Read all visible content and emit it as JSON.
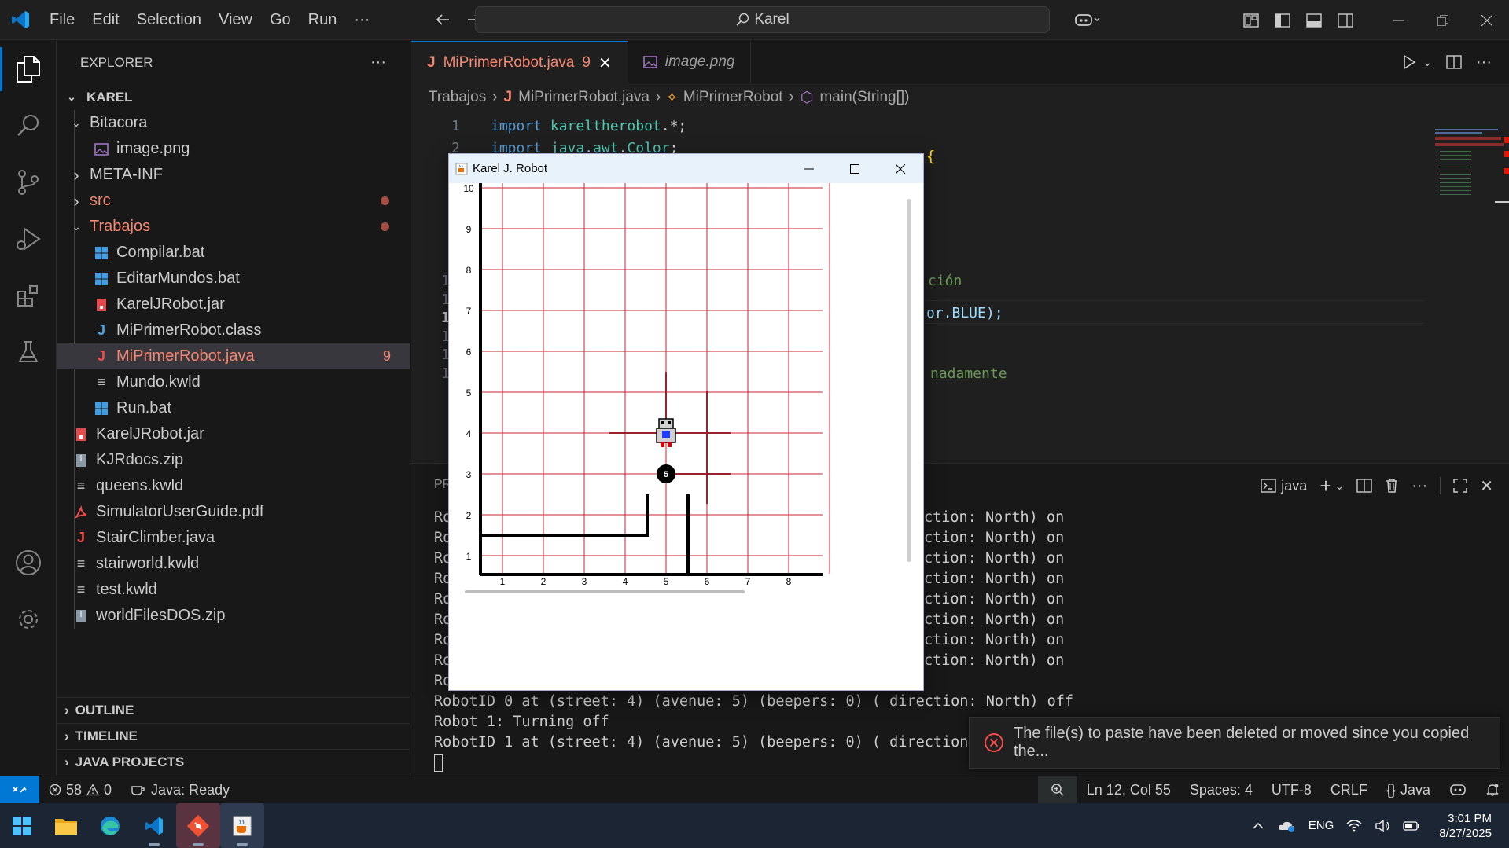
{
  "titlebar": {
    "menus": [
      "File",
      "Edit",
      "Selection",
      "View",
      "Go",
      "Run",
      "···"
    ],
    "search": "Karel",
    "window_controls": [
      "minimize",
      "restore",
      "close"
    ]
  },
  "sidebar": {
    "title": "EXPLORER",
    "more": "···",
    "root": "KAREL",
    "items": [
      {
        "label": "Bitacora",
        "kind": "folder-open",
        "depth": 1
      },
      {
        "label": "image.png",
        "kind": "image",
        "depth": 2
      },
      {
        "label": "META-INF",
        "kind": "folder",
        "depth": 1
      },
      {
        "label": "src",
        "kind": "folder",
        "depth": 1,
        "red": true,
        "dot": true
      },
      {
        "label": "Trabajos",
        "kind": "folder-open",
        "depth": 1,
        "red": true,
        "dot": true
      },
      {
        "label": "Compilar.bat",
        "kind": "windows",
        "depth": 2
      },
      {
        "label": "EditarMundos.bat",
        "kind": "windows",
        "depth": 2
      },
      {
        "label": "KarelJRobot.jar",
        "kind": "jar",
        "depth": 2
      },
      {
        "label": "MiPrimerRobot.class",
        "kind": "java-class",
        "depth": 2
      },
      {
        "label": "MiPrimerRobot.java",
        "kind": "java",
        "depth": 2,
        "red": true,
        "selected": true,
        "count": "9"
      },
      {
        "label": "Mundo.kwld",
        "kind": "text",
        "depth": 2
      },
      {
        "label": "Run.bat",
        "kind": "windows",
        "depth": 2
      },
      {
        "label": "KarelJRobot.jar",
        "kind": "jar",
        "depth": 1
      },
      {
        "label": "KJRdocs.zip",
        "kind": "zip",
        "depth": 1
      },
      {
        "label": "queens.kwld",
        "kind": "text",
        "depth": 1
      },
      {
        "label": "SimulatorUserGuide.pdf",
        "kind": "pdf",
        "depth": 1
      },
      {
        "label": "StairClimber.java",
        "kind": "java",
        "depth": 1
      },
      {
        "label": "stairworld.kwld",
        "kind": "text",
        "depth": 1
      },
      {
        "label": "test.kwld",
        "kind": "text",
        "depth": 1
      },
      {
        "label": "worldFilesDOS.zip",
        "kind": "zip",
        "depth": 1
      }
    ],
    "sections": [
      "OUTLINE",
      "TIMELINE",
      "JAVA PROJECTS"
    ]
  },
  "editor": {
    "tabs": [
      {
        "label": "MiPrimerRobot.java",
        "badge": "9",
        "active": true
      },
      {
        "label": "image.png",
        "active": false
      }
    ],
    "breadcrumb": [
      "Trabajos",
      "MiPrimerRobot.java",
      "MiPrimerRobot",
      "main(String[])"
    ],
    "code": [
      {
        "ln": "1",
        "parts": [
          [
            "import ",
            "kw"
          ],
          [
            "kareltherobot",
            "pkg"
          ],
          [
            ".*;",
            "plain"
          ]
        ]
      },
      {
        "ln": "2",
        "parts": [
          [
            "import ",
            "kw"
          ],
          [
            "java",
            "pkg"
          ],
          [
            ".",
            "plain"
          ],
          [
            "awt",
            "pkg"
          ],
          [
            ".",
            "plain"
          ],
          [
            "Color",
            "pkg"
          ],
          [
            ";",
            "plain"
          ]
        ]
      }
    ],
    "peek": {
      "brace": "{",
      "comment1": "ción",
      "color_line": "or.BLUE);",
      "comment2": "nadamente"
    }
  },
  "panel": {
    "tab_partial": "PR",
    "terminal_name": "java",
    "lines_prefix": [
      "Ro",
      "Ro",
      "Ro",
      "Ro",
      "Ro",
      "Ro",
      "Ro",
      "Ro",
      "Ro"
    ],
    "lines_suffix": [
      "ction: North) on",
      "ction: North) on",
      "ction: North) on",
      "ction: North) on",
      "ction: North) on",
      "ction: North) on",
      "ction: North) on",
      "ction: North) on"
    ],
    "full_lines": [
      "RobotID 0 at (street: 4) (avenue: 5) (beepers: 0) ( direction: North) off",
      "Robot 1: Turning off",
      "RobotID 1 at (street: 4) (avenue: 5) (beepers: 0) ( direction:"
    ]
  },
  "toast": {
    "message": "The file(s) to paste have been deleted or moved since you copied the..."
  },
  "statusbar": {
    "errors": "58",
    "warnings": "0",
    "java_status": "Java: Ready",
    "position": "Ln 12, Col 55",
    "spaces": "Spaces: 4",
    "encoding": "UTF-8",
    "eol": "CRLF",
    "language": "Java"
  },
  "karel_window": {
    "title": "Karel J. Robot",
    "y_labels": [
      "10",
      "9",
      "8",
      "7",
      "6",
      "5",
      "4",
      "3",
      "2",
      "1"
    ],
    "x_labels": [
      "1",
      "2",
      "3",
      "4",
      "5",
      "6",
      "7",
      "8"
    ],
    "beeper_count": "5",
    "robot": {
      "street": 4,
      "avenue": 5
    },
    "beeper": {
      "street": 3,
      "avenue": 5
    }
  },
  "taskbar": {
    "language": "ENG",
    "time": "3:01 PM",
    "date": "8/27/2025"
  },
  "colors": {
    "accent": "#0078d4",
    "error": "#f48771",
    "grid": "#cc2233",
    "keyword": "#569cd6",
    "package": "#4ec9b0"
  }
}
